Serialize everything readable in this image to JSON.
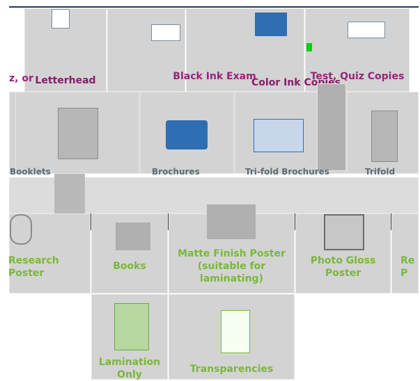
{
  "row1": {
    "items": [
      {
        "label": "z, or"
      },
      {
        "label": "Letterhead"
      },
      {
        "label": "Black Ink Exam"
      },
      {
        "label": "Color Ink Copies"
      },
      {
        "label": "Test, Quiz Copies"
      }
    ]
  },
  "row2": {
    "items": [
      {
        "label": "Booklets"
      },
      {
        "label": "Brochures"
      },
      {
        "label": "Tri-fold Brochures"
      },
      {
        "label": "Trifold"
      }
    ]
  },
  "row3": {
    "items": [
      {
        "label": "Research Poster"
      },
      {
        "label": "Books"
      },
      {
        "label": "Matte Finish Poster (suitable for laminating)"
      },
      {
        "label": "Photo Gloss Poster"
      },
      {
        "label": "Re P"
      }
    ]
  },
  "row4": {
    "items": [
      {
        "label": "Lamination Only"
      },
      {
        "label": "Transparencies"
      }
    ]
  },
  "colors": {
    "green": "#79b83a",
    "purple": "#96257a",
    "tile": "#d3d3d3",
    "navy": "#1f3a5f"
  }
}
